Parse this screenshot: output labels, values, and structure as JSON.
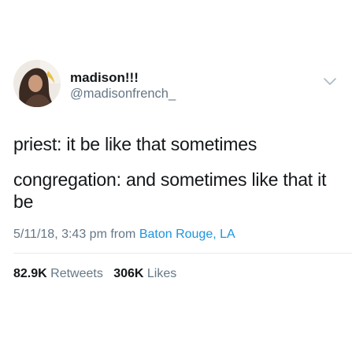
{
  "user": {
    "display_name": "madison!!!",
    "handle": "@madisonfrench_"
  },
  "tweet": {
    "lines": [
      "priest: it be like that sometimes",
      "congregation: and sometimes like that it",
      "be"
    ],
    "timestamp": "5/11/18, 3:43 pm",
    "from_label": "from",
    "location": "Baton Rouge, LA"
  },
  "stats": {
    "retweets_count": "82.9K",
    "retweets_label": "Retweets",
    "likes_count": "306K",
    "likes_label": "Likes"
  },
  "icons": {
    "menu": "chevron-down-icon"
  },
  "colors": {
    "text": "#14171a",
    "secondary": "#657786",
    "link": "#1b95e0",
    "divider": "#e6ecf0"
  }
}
